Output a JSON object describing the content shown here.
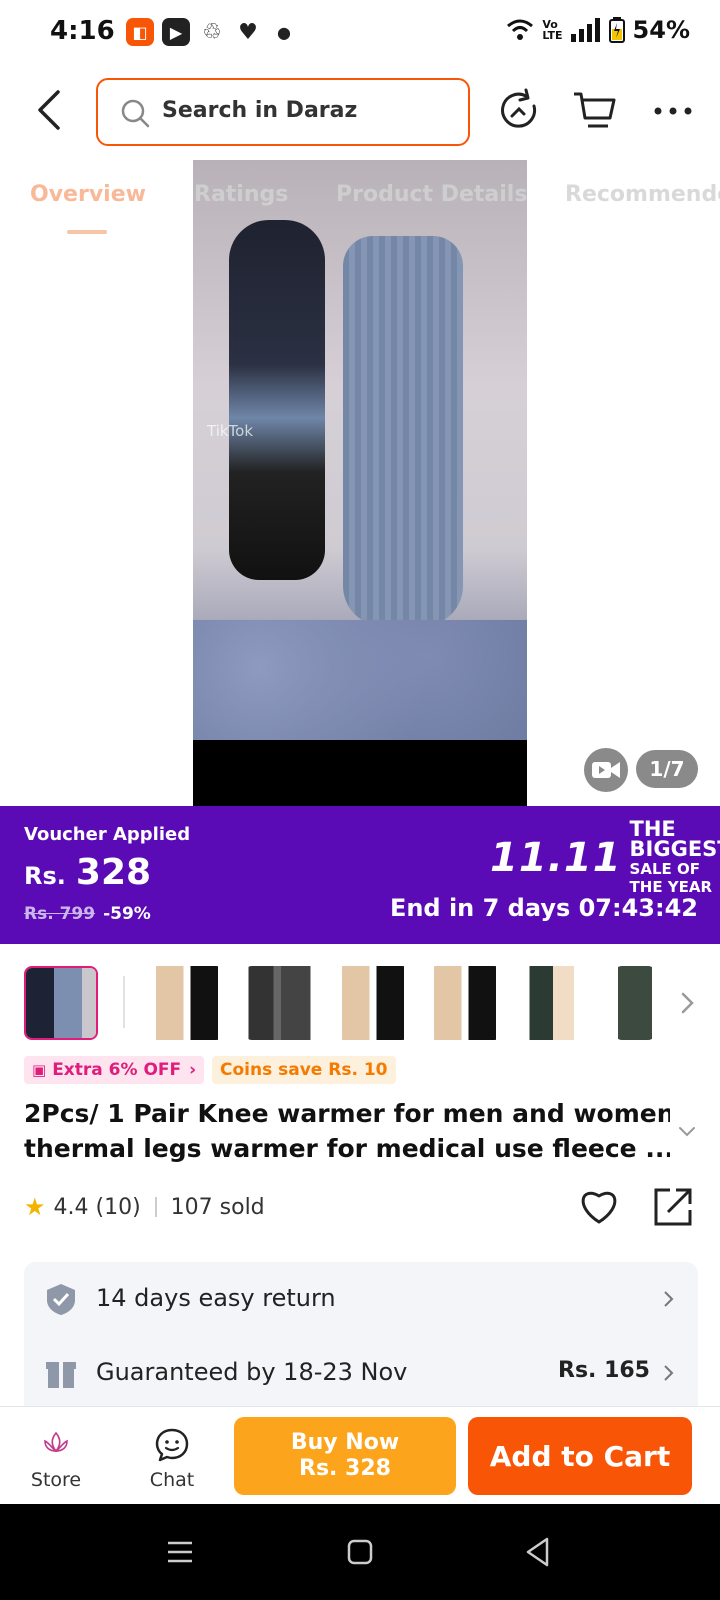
{
  "status_bar": {
    "time": "4:16",
    "battery": "54%",
    "icons": [
      "daraz-app-icon",
      "youtube-icon",
      "recycle-icon",
      "heart-icon",
      "dot-icon",
      "wifi-icon",
      "volte-icon",
      "signal-icon",
      "battery-icon"
    ]
  },
  "search": {
    "placeholder": "Search in Daraz"
  },
  "tabs": [
    {
      "label": "Overview",
      "active": true
    },
    {
      "label": "Ratings",
      "active": false
    },
    {
      "label": "Product Details",
      "active": false
    },
    {
      "label": "Recommended",
      "active": false
    }
  ],
  "media": {
    "counter": "1/7",
    "watermark": "TikTok"
  },
  "voucher": {
    "label": "Voucher Applied",
    "currency": "Rs.",
    "price": "328",
    "original_price": "Rs. 799",
    "discount": "-59%",
    "sale_number": "11.11",
    "sale_line1": "THE BIGGEST",
    "sale_line2": "SALE OF THE YEAR",
    "timer": "End in 7 days 07:43:42"
  },
  "badges": {
    "extra": "Extra 6% OFF",
    "coins": "Coins save Rs. 10"
  },
  "product": {
    "title_line1": "2Pcs/ 1 Pair Knee warmer for men and women",
    "title_line2": "thermal legs warmer for medical  use fleece ...",
    "rating": "4.4 (10)",
    "sold": "107 sold"
  },
  "services": [
    {
      "text": "14 days easy return",
      "right": "",
      "icon": "shield-check-icon"
    },
    {
      "text": "Guaranteed by 18-23 Nov",
      "right": "Rs. 165",
      "icon": "package-icon"
    }
  ],
  "actions": {
    "store": "Store",
    "chat": "Chat",
    "buy_now": "Buy Now",
    "buy_price": "Rs. 328",
    "add_to_cart": "Add to Cart"
  },
  "colors": {
    "brand_orange": "#f85606",
    "buy_now": "#fca41c",
    "voucher_purple": "#5b0bb5",
    "pink": "#e01d7c"
  }
}
